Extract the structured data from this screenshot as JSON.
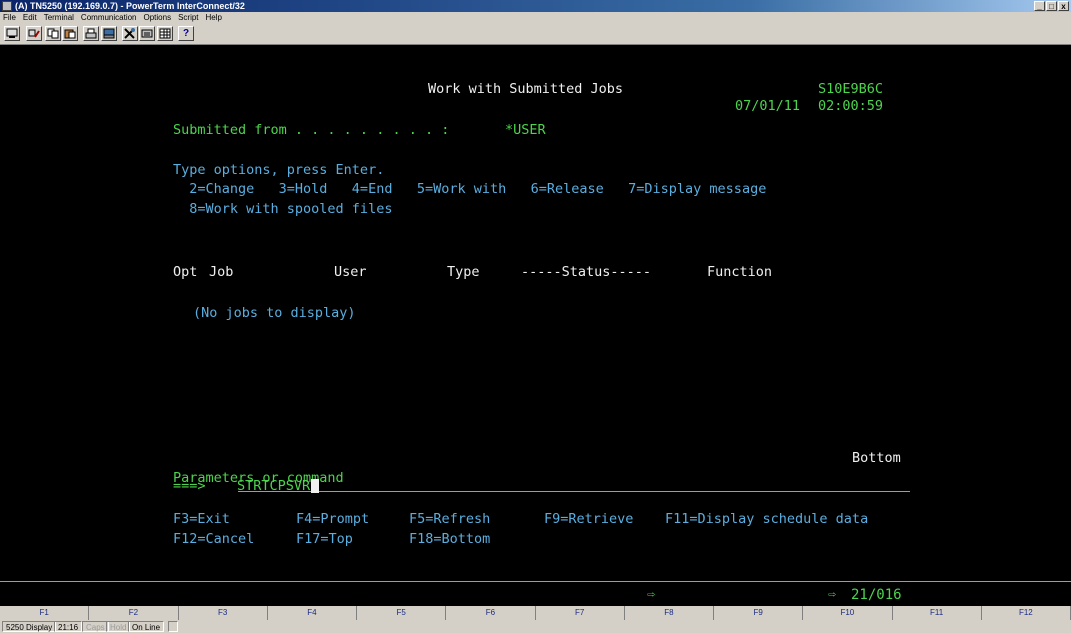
{
  "window": {
    "title": "(A) TN5250 (192.169.0.7) - PowerTerm InterConnect/32",
    "controls": [
      "_",
      "□",
      "x"
    ]
  },
  "menu": [
    "File",
    "Edit",
    "Terminal",
    "Communication",
    "Options",
    "Script",
    "Help"
  ],
  "toolbar": {
    "icons": [
      "session-icon",
      "connect-icon",
      "copy-icon",
      "paste-icon",
      "print-icon",
      "keyboard-icon",
      "settings-icon",
      "keypad-icon",
      "grid-icon",
      "help-icon"
    ],
    "help_glyph": "?"
  },
  "screen": {
    "title": "Work with Submitted Jobs",
    "system": "S10E9B6C",
    "date": "07/01/11",
    "time": "02:00:59",
    "submitted_label": "Submitted from . . . . . . . . . :",
    "submitted_value": "*USER",
    "instructions": "Type options, press Enter.",
    "options_line1": "  2=Change   3=Hold   4=End   5=Work with   6=Release   7=Display message",
    "options_line2": "  8=Work with spooled files",
    "columns": {
      "opt": "Opt",
      "job": "Job",
      "user": "User",
      "type": "Type",
      "status": "-----Status-----",
      "function": "Function"
    },
    "empty_message": "(No jobs to display)",
    "bottom": "Bottom",
    "params_label": "Parameters or command",
    "prompt": "===>",
    "command": "STRTCPSVR",
    "fkeys_line1": {
      "f3": "F3=Exit",
      "f4": "F4=Prompt",
      "f5": "F5=Refresh",
      "f9": "F9=Retrieve",
      "f11": "F11=Display schedule data"
    },
    "fkeys_line2": {
      "f12": "F12=Cancel",
      "f17": "F17=Top",
      "f18": "F18=Bottom"
    }
  },
  "oia": {
    "arrow": "⇨",
    "cursor_arrow": "⇨",
    "cursor_position": "21/016"
  },
  "function_keys": [
    "F1",
    "F2",
    "F3",
    "F4",
    "F5",
    "F6",
    "F7",
    "F8",
    "F9",
    "F10",
    "F11",
    "F12"
  ],
  "status_bar": {
    "mode": "5250 Display",
    "position": "21:16",
    "caps": "Caps",
    "hold": "Hold",
    "online": "On Line"
  }
}
